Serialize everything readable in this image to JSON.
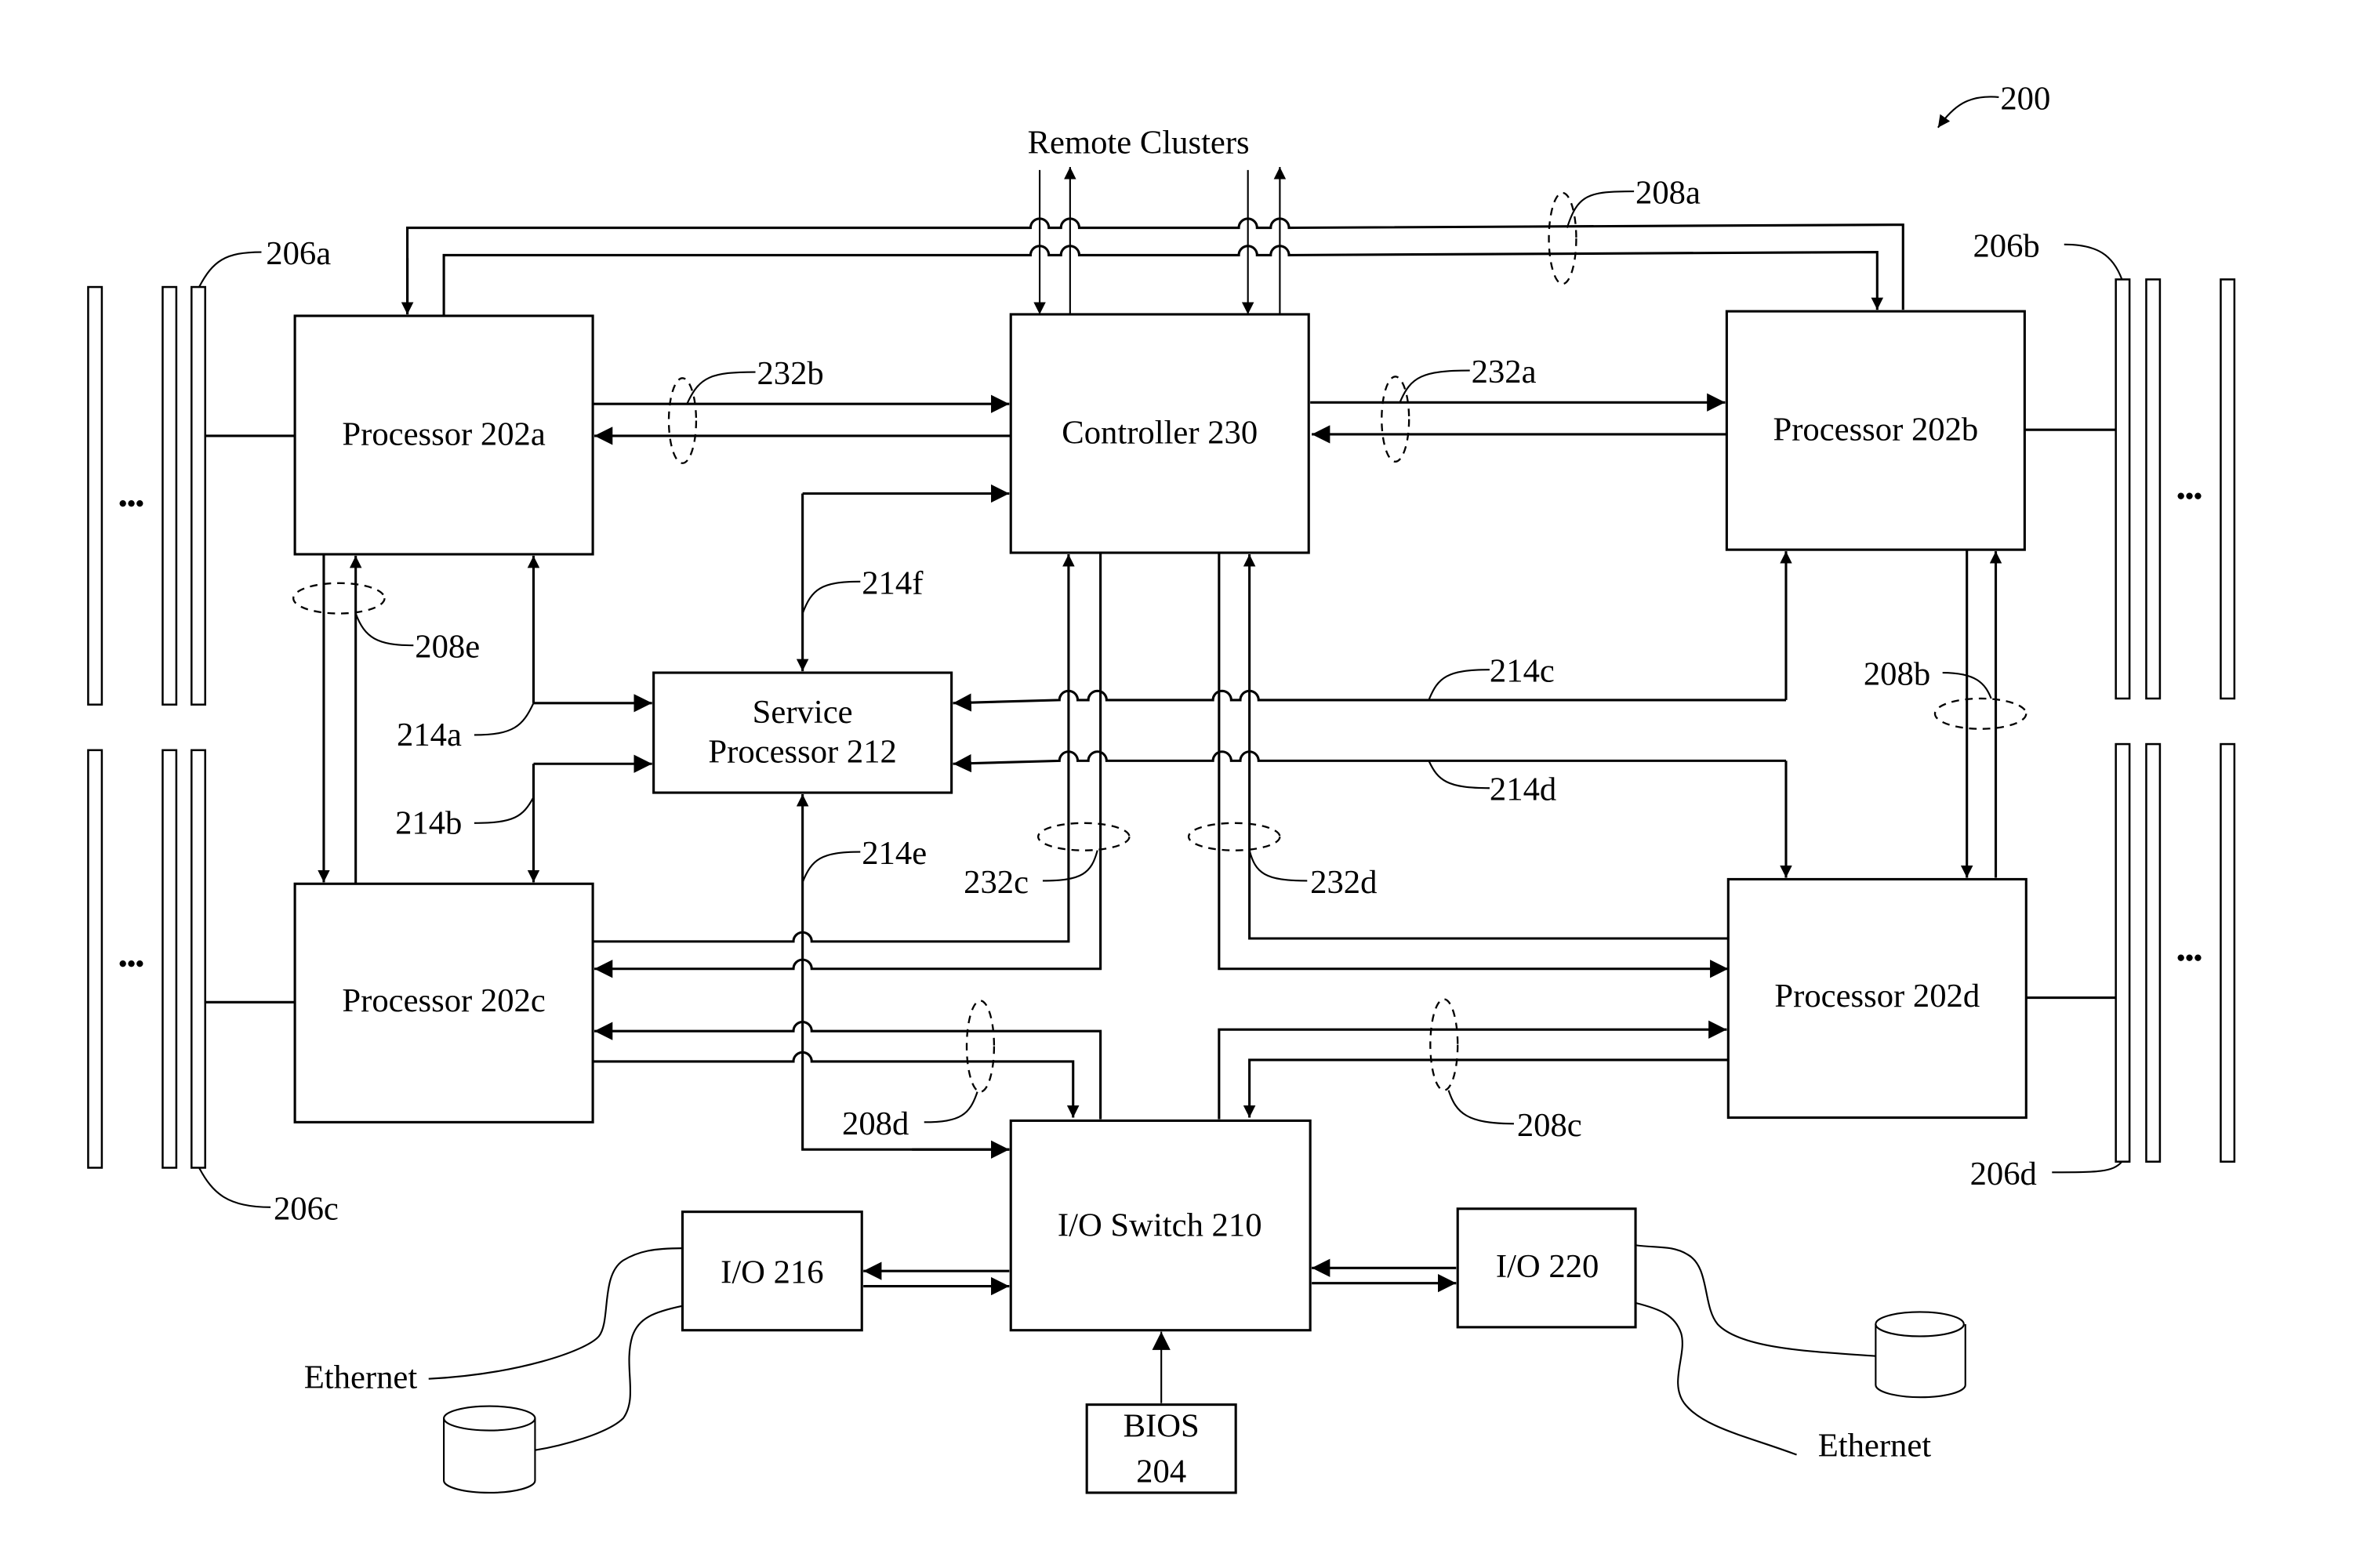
{
  "figure": {
    "ref": "200",
    "remote_clusters_label": "Remote Clusters"
  },
  "blocks": {
    "processor_a": "Processor 202a",
    "processor_b": "Processor 202b",
    "processor_c": "Processor 202c",
    "processor_d": "Processor 202d",
    "controller": "Controller 230",
    "service_processor_line1": "Service",
    "service_processor_line2": "Processor 212",
    "io_switch": "I/O Switch 210",
    "io_216": "I/O 216",
    "io_220": "I/O 220",
    "bios_line1": "BIOS",
    "bios_line2": "204"
  },
  "memory_refs": {
    "a": "206a",
    "b": "206b",
    "c": "206c",
    "d": "206d",
    "ellipsis": "•••"
  },
  "bus_refs": {
    "b208a": "208a",
    "b208b": "208b",
    "b208c": "208c",
    "b208d": "208d",
    "b208e": "208e",
    "b232a": "232a",
    "b232b": "232b",
    "b232c": "232c",
    "b232d": "232d",
    "b214a": "214a",
    "b214b": "214b",
    "b214c": "214c",
    "b214d": "214d",
    "b214e": "214e",
    "b214f": "214f"
  },
  "peripherals": {
    "ethernet_left": "Ethernet",
    "ethernet_right": "Ethernet"
  }
}
